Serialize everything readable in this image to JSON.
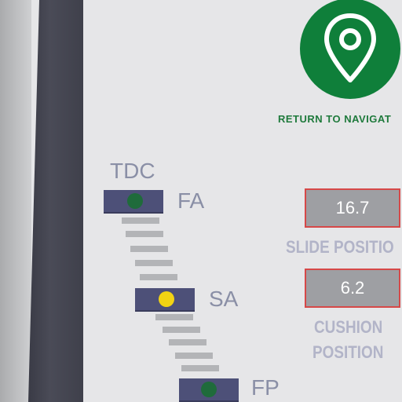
{
  "navigation": {
    "label": "RETURN TO NAVIGAT",
    "icon": "location-pin-icon"
  },
  "stages": {
    "tdc_label": "TDC",
    "fa_label": "FA",
    "sa_label": "SA",
    "fp_label": "FP"
  },
  "readouts": {
    "slide": {
      "value": "16.7",
      "label": "SLIDE POSITIO"
    },
    "cushion": {
      "value": "6.2",
      "label_line1": "CUSHION",
      "label_line2": "POSITION"
    }
  },
  "colors": {
    "nav_green": "#0f7f3a",
    "indicator_green": "#1f6b3b",
    "indicator_yellow": "#f2d313",
    "box_border_red": "#d64848"
  }
}
